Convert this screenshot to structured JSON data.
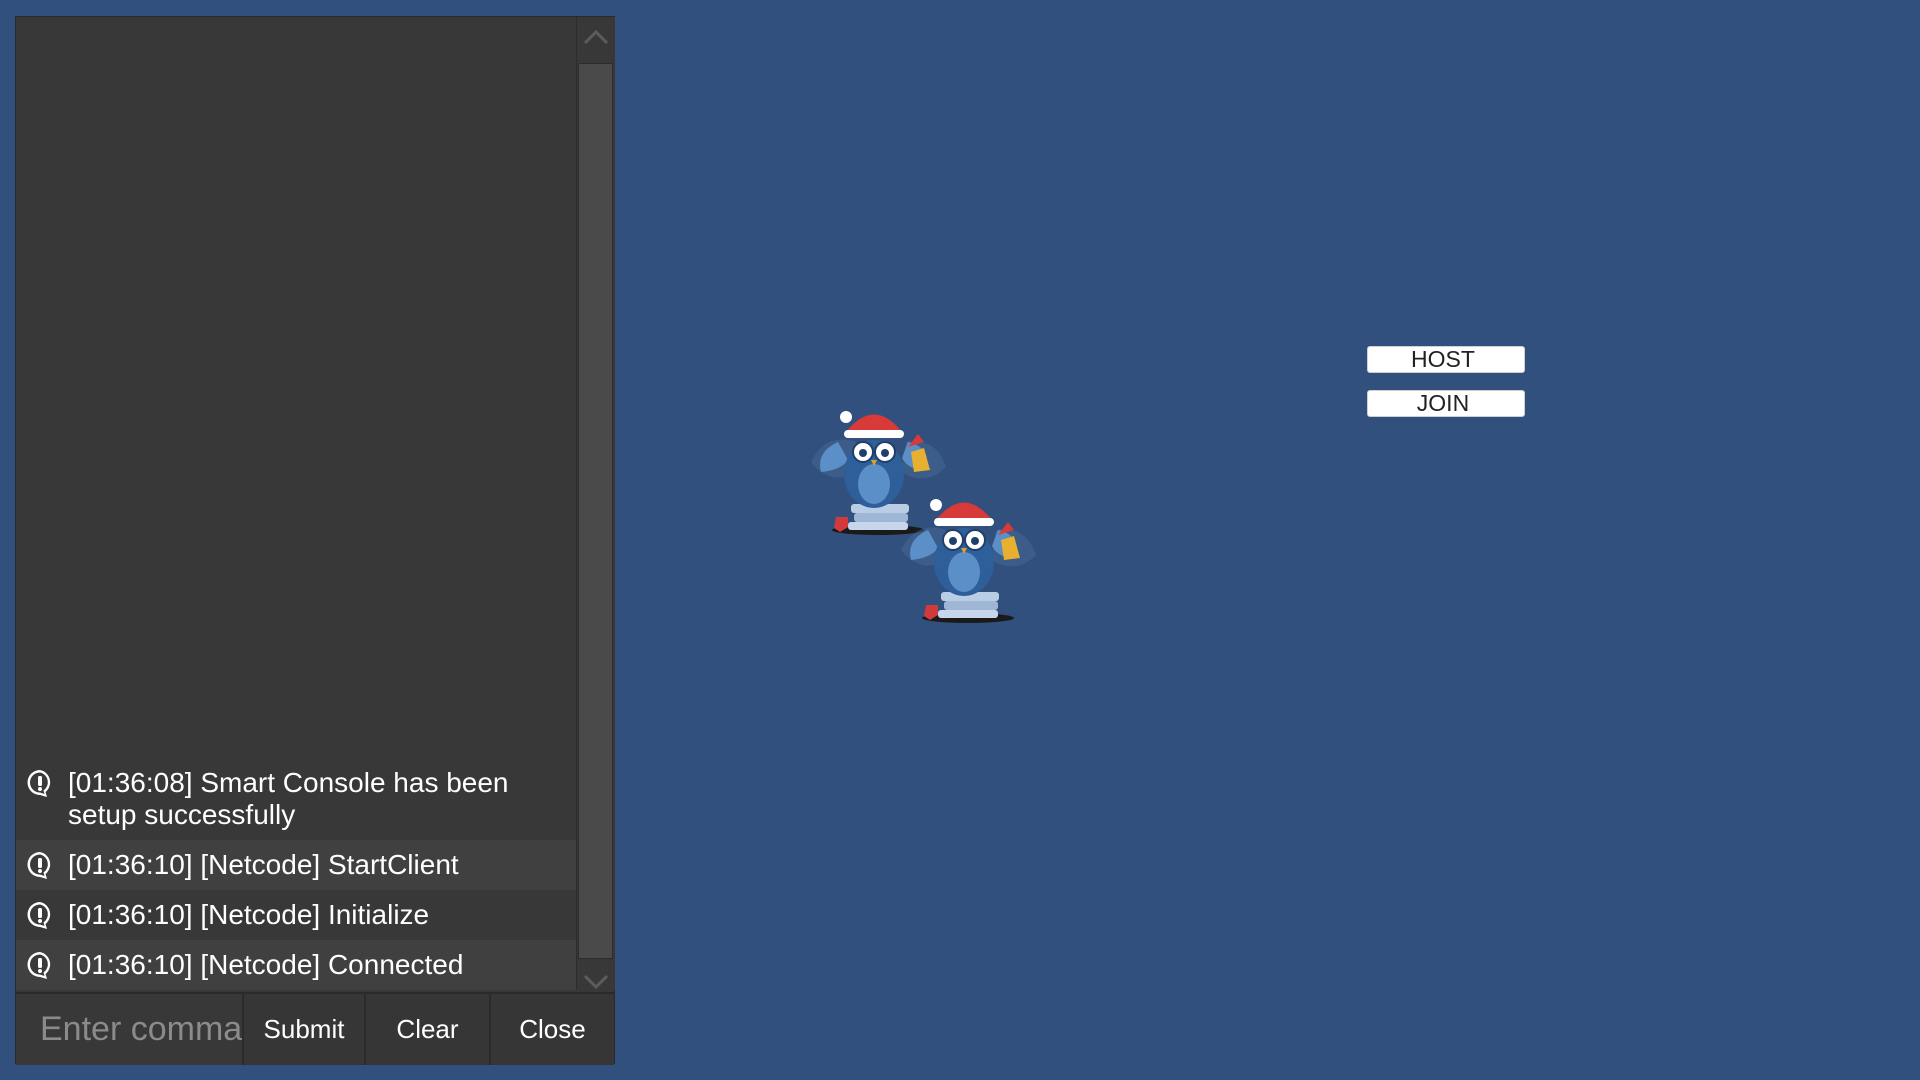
{
  "console": {
    "log_entries": [
      {
        "text": "[01:36:08] Smart Console has been setup successfully",
        "icon": "info-bubble-icon"
      },
      {
        "text": "[01:36:10] [Netcode] StartClient",
        "icon": "info-bubble-icon"
      },
      {
        "text": "[01:36:10] [Netcode] Initialize",
        "icon": "info-bubble-icon"
      },
      {
        "text": "[01:36:10] [Netcode] Connected",
        "icon": "info-bubble-icon"
      }
    ],
    "input_placeholder": "Enter command",
    "submit_label": "Submit",
    "clear_label": "Clear",
    "close_label": "Close"
  },
  "network": {
    "host_label": "HOST",
    "join_label": "JOIN"
  },
  "sprites": [
    {
      "name": "christmas-owl",
      "description_icon": "owl-santa-hat-icon"
    },
    {
      "name": "christmas-owl",
      "description_icon": "owl-santa-hat-icon"
    }
  ],
  "colors": {
    "background": "#32507d",
    "console_bg": "#383838",
    "log_alt_row": "#404040"
  }
}
